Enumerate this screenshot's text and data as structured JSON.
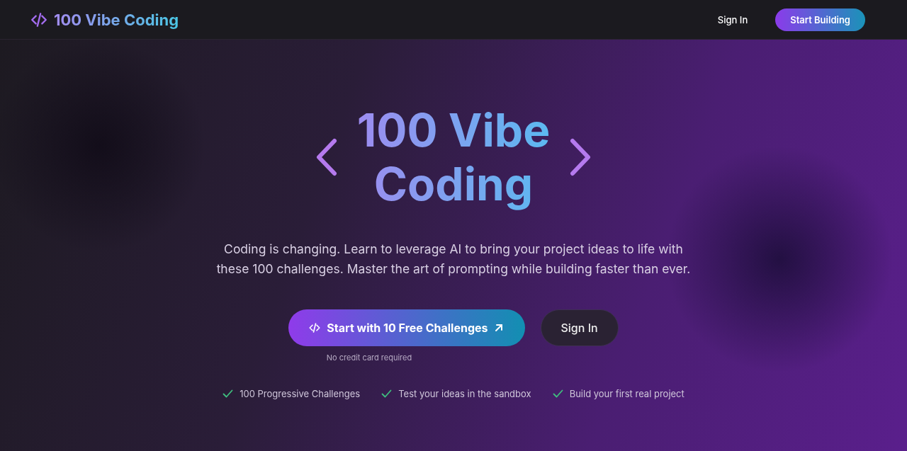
{
  "header": {
    "logo": "100 Vibe Coding",
    "sign_in": "Sign In",
    "cta": "Start Building"
  },
  "hero": {
    "title_lines": [
      "100 Vibe",
      "Coding"
    ],
    "description": "Coding is changing. Learn to leverage AI to bring your project ideas to life with these 100 challenges. Master the art of prompting while building faster than ever.",
    "primary_button": "Start with 10 Free Challenges",
    "secondary_button": "Sign In",
    "note": "No credit card required",
    "features": [
      "100 Progressive Challenges",
      "Test your ideas in the sandbox",
      "Build your first real project"
    ]
  }
}
